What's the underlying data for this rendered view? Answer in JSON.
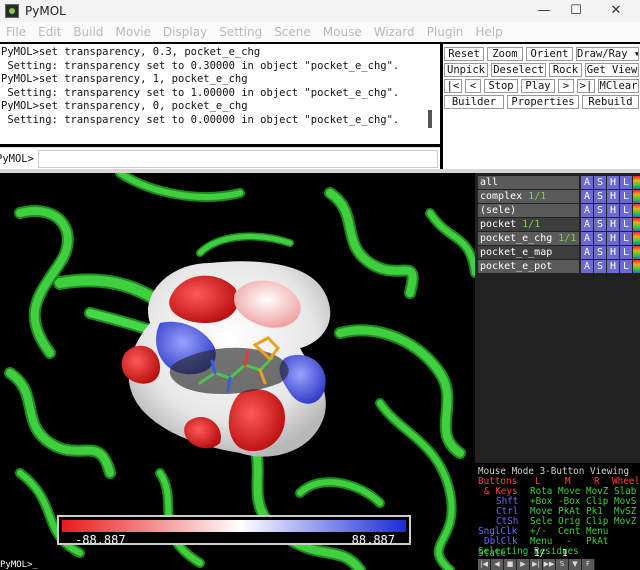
{
  "window": {
    "title": "PyMOL",
    "controls": [
      "—",
      "☐",
      "✕"
    ]
  },
  "menubar": [
    "File",
    "Edit",
    "Build",
    "Movie",
    "Display",
    "Setting",
    "Scene",
    "Mouse",
    "Wizard",
    "Plugin",
    "Help"
  ],
  "console": {
    "lines": [
      "PyMOL>set transparency, 0.3, pocket_e_chg",
      " Setting: transparency set to 0.30000 in object \"pocket_e_chg\".",
      "PyMOL>set transparency, 1, pocket_e_chg",
      " Setting: transparency set to 1.00000 in object \"pocket_e_chg\".",
      "PyMOL>set transparency, 0, pocket_e_chg",
      " Setting: transparency set to 0.00000 in object \"pocket_e_chg\"."
    ]
  },
  "command": {
    "prompt": "PyMOL>",
    "value": ""
  },
  "controls": {
    "row1": [
      "Reset",
      "Zoom",
      "Orient",
      "Draw/Ray ▾"
    ],
    "row2": [
      "Unpick",
      "Deselect",
      "Rock",
      "Get View"
    ],
    "row3": [
      "|<",
      "<",
      "Stop",
      "Play",
      ">",
      ">|",
      "MClear"
    ],
    "row4": [
      "Builder",
      "Properties",
      "Rebuild"
    ]
  },
  "objects": [
    {
      "name": "all",
      "count": "",
      "enabled": true
    },
    {
      "name": "complex",
      "count": "1/1",
      "enabled": true
    },
    {
      "name": "(sele)",
      "count": "",
      "enabled": true
    },
    {
      "name": "pocket",
      "count": "1/1",
      "enabled": false
    },
    {
      "name": "pocket_e_chg",
      "count": "1/1",
      "enabled": true
    },
    {
      "name": "pocket_e_map",
      "count": "",
      "enabled": false
    },
    {
      "name": "pocket_e_pot",
      "count": "",
      "enabled": true
    }
  ],
  "object_buttons": [
    "A",
    "S",
    "H",
    "L",
    "C"
  ],
  "colorbar": {
    "min_label": "-88.887",
    "max_label": "88.887"
  },
  "viewport_prompt": "PyMOL>_",
  "mouse_mode": {
    "header": "Mouse Mode 3-Button Viewing",
    "buttons_row": {
      "label": "Buttons",
      "cols": [
        "L",
        "M",
        "R",
        "Wheel"
      ]
    },
    "rows": [
      {
        "label": "& Keys",
        "vals": [
          "Rota",
          "Move",
          "MovZ",
          "Slab"
        ]
      },
      {
        "label": "Shft",
        "vals": [
          "+Box",
          "-Box",
          "Clip",
          "MovS"
        ]
      },
      {
        "label": "Ctrl",
        "vals": [
          "Move",
          "PkAt",
          "Pk1",
          "MvSZ"
        ]
      },
      {
        "label": "CtSh",
        "vals": [
          "Sele",
          "Orig",
          "Clip",
          "MovZ"
        ]
      },
      {
        "label": "SnglClk",
        "vals": [
          "+/-",
          "Cent",
          "Menu",
          ""
        ]
      },
      {
        "label": "DblClk",
        "vals": [
          "Menu",
          "-",
          "PkAt",
          ""
        ]
      }
    ],
    "selecting": "Selecting Residues",
    "state": {
      "label": "State",
      "value": "1/",
      "total": "1"
    }
  },
  "transport": [
    "|◀",
    "◀",
    "■",
    "▶",
    "▶|",
    "▶▶",
    "S",
    "▼",
    "F"
  ],
  "colors": {
    "ribbon": "#3fcf3f",
    "ribbon_dark": "#1e8a1e",
    "negative": "#e81b1b",
    "neutral": "#ffffff",
    "positive": "#1a2bd8",
    "mouse_red": "#ff4040",
    "mouse_blue": "#6b6bff",
    "mouse_green": "#40d040"
  }
}
